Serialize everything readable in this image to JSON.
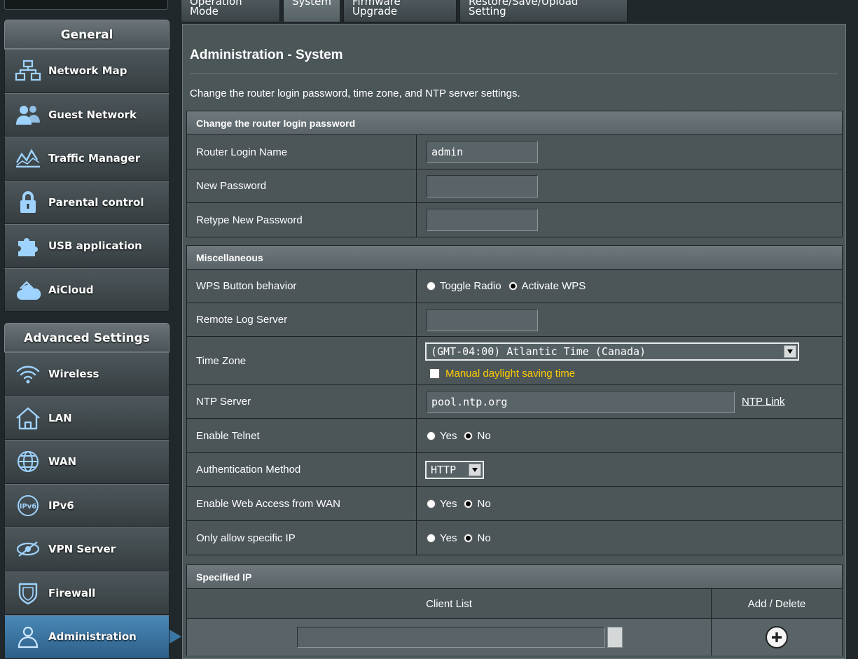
{
  "sidebar": {
    "general_title": "General",
    "general_items": [
      {
        "label": "Network Map",
        "icon": "network-map-icon"
      },
      {
        "label": "Guest Network",
        "icon": "guest-network-icon"
      },
      {
        "label": "Traffic Manager",
        "icon": "traffic-manager-icon"
      },
      {
        "label": "Parental control",
        "icon": "lock-icon"
      },
      {
        "label": "USB application",
        "icon": "puzzle-icon"
      },
      {
        "label": "AiCloud",
        "icon": "cloud-icon"
      }
    ],
    "advanced_title": "Advanced Settings",
    "advanced_items": [
      {
        "label": "Wireless",
        "icon": "wifi-icon"
      },
      {
        "label": "LAN",
        "icon": "house-icon"
      },
      {
        "label": "WAN",
        "icon": "globe-icon"
      },
      {
        "label": "IPv6",
        "icon": "ipv6-icon"
      },
      {
        "label": "VPN Server",
        "icon": "vpn-icon"
      },
      {
        "label": "Firewall",
        "icon": "shield-icon"
      },
      {
        "label": "Administration",
        "icon": "person-icon",
        "active": true
      }
    ]
  },
  "tabs": [
    {
      "label": "Operation Mode"
    },
    {
      "label": "System",
      "active": true
    },
    {
      "label": "Firmware Upgrade"
    },
    {
      "label": "Restore/Save/Upload Setting"
    }
  ],
  "page": {
    "title": "Administration - System",
    "description": "Change the router login password, time zone, and NTP server settings."
  },
  "login_section": {
    "header": "Change the router login password",
    "login_name_label": "Router Login Name",
    "login_name_value": "admin",
    "new_password_label": "New Password",
    "new_password_value": "",
    "retype_password_label": "Retype New Password",
    "retype_password_value": ""
  },
  "misc_section": {
    "header": "Miscellaneous",
    "wps_label": "WPS Button behavior",
    "wps_options": [
      "Toggle Radio",
      "Activate WPS"
    ],
    "wps_selected": "Activate WPS",
    "remote_log_label": "Remote Log Server",
    "remote_log_value": "",
    "timezone_label": "Time Zone",
    "timezone_value": "(GMT-04:00) Atlantic Time (Canada)",
    "manual_dst_label": "Manual daylight saving time",
    "manual_dst_checked": false,
    "ntp_label": "NTP Server",
    "ntp_value": "pool.ntp.org",
    "ntp_link": "NTP Link",
    "telnet_label": "Enable Telnet",
    "auth_label": "Authentication Method",
    "auth_value": "HTTP",
    "web_access_label": "Enable Web Access from WAN",
    "specific_ip_label": "Only allow specific IP",
    "yes": "Yes",
    "no": "No"
  },
  "specified_ip": {
    "header": "Specified IP",
    "col_client_list": "Client List",
    "col_add_delete": "Add / Delete",
    "client_value": ""
  },
  "colors": {
    "active_blue": "#3a76a3",
    "panel": "#4b5659",
    "highlight_text": "#ffcc00"
  }
}
